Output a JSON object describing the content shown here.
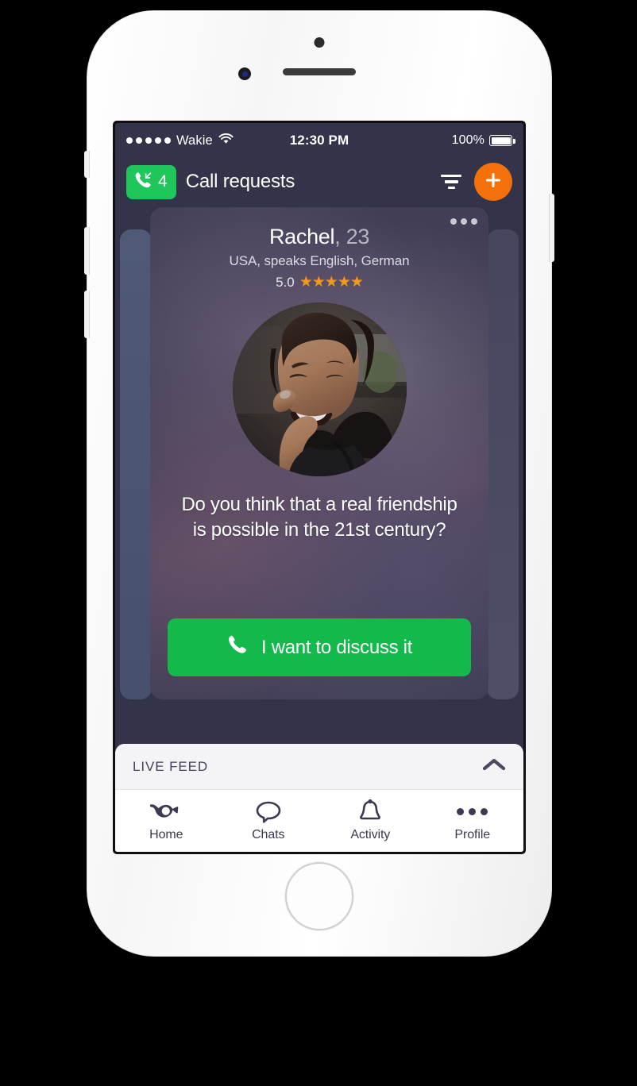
{
  "statusbar": {
    "carrier": "Wakie",
    "time": "12:30 PM",
    "battery_percent": "100%",
    "signal_icon": "signal-dots-icon",
    "wifi_icon": "wifi-icon",
    "battery_icon": "battery-full-icon"
  },
  "navbar": {
    "call_requests_count": "4",
    "call_requests_icon": "incoming-call-icon",
    "title": "Call requests",
    "filter_icon": "filter-icon",
    "add_icon": "plus-icon"
  },
  "card": {
    "menu_icon": "more-options-icon",
    "name": "Rachel",
    "age": "23",
    "name_separator": ",",
    "meta": "USA, speaks English, German",
    "rating_score": "5.0",
    "stars": "★★★★★",
    "avatar_icon": "user-avatar-photo",
    "question": "Do you think that a real friendship is possible in the 21st century?",
    "cta_label": "I want to discuss it",
    "cta_icon": "phone-icon"
  },
  "livefeed": {
    "label": "LIVE FEED",
    "collapse_icon": "chevron-up-icon"
  },
  "tabs": [
    {
      "label": "Home",
      "icon": "wakie-horn-icon",
      "active": true
    },
    {
      "label": "Chats",
      "icon": "chat-bubble-icon",
      "active": false
    },
    {
      "label": "Activity",
      "icon": "bell-icon",
      "active": false
    },
    {
      "label": "Profile",
      "icon": "more-dots-icon",
      "active": false
    }
  ],
  "colors": {
    "accent_green": "#13b94a",
    "badge_green": "#1fc65a",
    "accent_orange": "#f4700a",
    "screen_bg": "#333349",
    "star_gold": "#f0981e",
    "tab_dark": "#3b3a52"
  }
}
